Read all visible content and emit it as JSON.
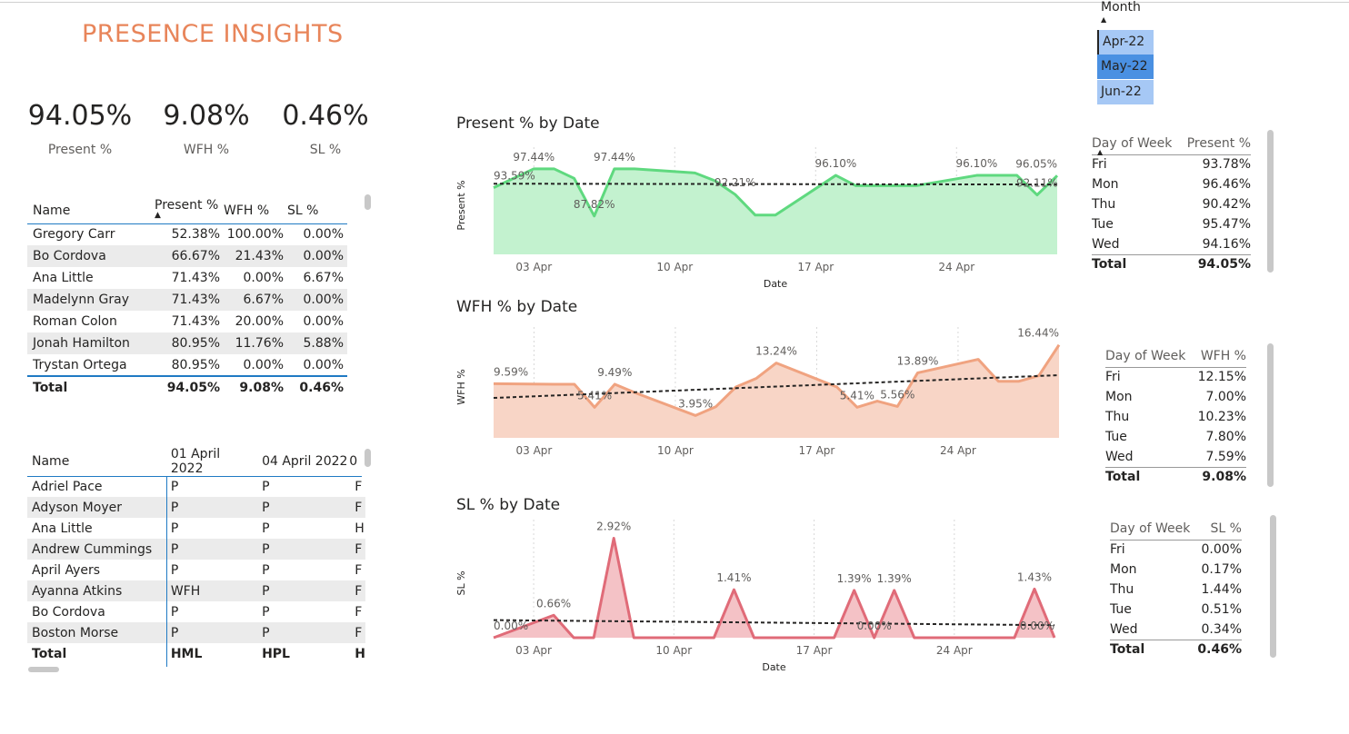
{
  "header": {
    "title": "PRESENCE INSIGHTS"
  },
  "kpis": [
    {
      "value": "94.05%",
      "label": "Present %"
    },
    {
      "value": "9.08%",
      "label": "WFH %"
    },
    {
      "value": "0.46%",
      "label": "SL %"
    }
  ],
  "month_slicer": {
    "label": "Month",
    "items": [
      "Apr-22",
      "May-22",
      "Jun-22"
    ],
    "selected": "May-22"
  },
  "summary_table": {
    "columns": [
      "Name",
      "Present %",
      "WFH %",
      "SL %"
    ],
    "rows": [
      [
        "Gregory Carr",
        "52.38%",
        "100.00%",
        "0.00%"
      ],
      [
        "Bo Cordova",
        "66.67%",
        "21.43%",
        "0.00%"
      ],
      [
        "Ana Little",
        "71.43%",
        "0.00%",
        "6.67%"
      ],
      [
        "Madelynn Gray",
        "71.43%",
        "6.67%",
        "0.00%"
      ],
      [
        "Roman Colon",
        "71.43%",
        "20.00%",
        "0.00%"
      ],
      [
        "Jonah Hamilton",
        "80.95%",
        "11.76%",
        "5.88%"
      ],
      [
        "Trystan Ortega",
        "80.95%",
        "0.00%",
        "0.00%"
      ]
    ],
    "total": [
      "Total",
      "94.05%",
      "9.08%",
      "0.46%"
    ]
  },
  "matrix_table": {
    "columns": [
      "Name",
      "01 April 2022",
      "04 April 2022",
      "0"
    ],
    "rows": [
      [
        "Adriel Pace",
        "P",
        "P",
        "F"
      ],
      [
        "Adyson Moyer",
        "P",
        "P",
        "F"
      ],
      [
        "Ana Little",
        "P",
        "P",
        "H"
      ],
      [
        "Andrew Cummings",
        "P",
        "P",
        "F"
      ],
      [
        "April Ayers",
        "P",
        "P",
        "F"
      ],
      [
        "Ayanna Atkins",
        "WFH",
        "P",
        "F"
      ],
      [
        "Bo Cordova",
        "P",
        "P",
        "F"
      ],
      [
        "Boston Morse",
        "P",
        "P",
        "F"
      ]
    ],
    "total": [
      "Total",
      "HML",
      "HPL",
      "H"
    ]
  },
  "day_tables": [
    {
      "columns": [
        "Day of Week",
        "Present %"
      ],
      "rows": [
        [
          "Fri",
          "93.78%"
        ],
        [
          "Mon",
          "96.46%"
        ],
        [
          "Thu",
          "90.42%"
        ],
        [
          "Tue",
          "95.47%"
        ],
        [
          "Wed",
          "94.16%"
        ]
      ],
      "total": [
        "Total",
        "94.05%"
      ]
    },
    {
      "columns": [
        "Day of Week",
        "WFH %"
      ],
      "rows": [
        [
          "Fri",
          "12.15%"
        ],
        [
          "Mon",
          "7.00%"
        ],
        [
          "Thu",
          "10.23%"
        ],
        [
          "Tue",
          "7.80%"
        ],
        [
          "Wed",
          "7.59%"
        ]
      ],
      "total": [
        "Total",
        "9.08%"
      ]
    },
    {
      "columns": [
        "Day of Week",
        "SL %"
      ],
      "rows": [
        [
          "Fri",
          "0.00%"
        ],
        [
          "Mon",
          "0.17%"
        ],
        [
          "Thu",
          "1.44%"
        ],
        [
          "Tue",
          "0.51%"
        ],
        [
          "Wed",
          "0.34%"
        ]
      ],
      "total": [
        "Total",
        "0.46%"
      ]
    }
  ],
  "chart_data": [
    {
      "type": "area",
      "title": "Present % by Date",
      "xlabel": "Date",
      "ylabel": "Present %",
      "x_ticks": [
        "03 Apr",
        "10 Apr",
        "17 Apr",
        "24 Apr"
      ],
      "color": "#5fd97f",
      "fill": "#c3f2cf",
      "trend": true,
      "ylim": [
        80,
        100
      ],
      "x": [
        "2022-04-01",
        "2022-04-03",
        "2022-04-04",
        "2022-04-05",
        "2022-04-06",
        "2022-04-07",
        "2022-04-08",
        "2022-04-11",
        "2022-04-12",
        "2022-04-13",
        "2022-04-14",
        "2022-04-15",
        "2022-04-18",
        "2022-04-19",
        "2022-04-20",
        "2022-04-21",
        "2022-04-22",
        "2022-04-25",
        "2022-04-26",
        "2022-04-27",
        "2022-04-28",
        "2022-04-29"
      ],
      "values": [
        93.59,
        97.44,
        97.44,
        95.5,
        87.82,
        97.44,
        97.44,
        96.6,
        95.0,
        92.21,
        88.0,
        88.0,
        96.1,
        94.0,
        94.0,
        94.0,
        94.0,
        96.1,
        96.1,
        96.1,
        92.11,
        96.05
      ],
      "labels": [
        {
          "x": "2022-04-01",
          "text": "93.59%"
        },
        {
          "x": "2022-04-03",
          "text": "97.44%"
        },
        {
          "x": "2022-04-06",
          "text": "87.82%"
        },
        {
          "x": "2022-04-07",
          "text": "97.44%"
        },
        {
          "x": "2022-04-13",
          "text": "92.21%"
        },
        {
          "x": "2022-04-18",
          "text": "96.10%"
        },
        {
          "x": "2022-04-25",
          "text": "96.10%"
        },
        {
          "x": "2022-04-28",
          "text": "92.11%"
        },
        {
          "x": "2022-04-29",
          "text": "96.05%"
        }
      ]
    },
    {
      "type": "area",
      "title": "WFH % by Date",
      "xlabel": "",
      "ylabel": "WFH %",
      "x_ticks": [
        "03 Apr",
        "10 Apr",
        "17 Apr",
        "24 Apr"
      ],
      "color": "#f0a380",
      "fill": "#f8d5c6",
      "trend": true,
      "ylim": [
        0,
        18
      ],
      "x": [
        "2022-04-01",
        "2022-04-04",
        "2022-04-05",
        "2022-04-06",
        "2022-04-07",
        "2022-04-08",
        "2022-04-11",
        "2022-04-12",
        "2022-04-13",
        "2022-04-14",
        "2022-04-15",
        "2022-04-18",
        "2022-04-19",
        "2022-04-20",
        "2022-04-21",
        "2022-04-22",
        "2022-04-25",
        "2022-04-26",
        "2022-04-27",
        "2022-04-28",
        "2022-04-29"
      ],
      "values": [
        9.59,
        9.49,
        9.49,
        5.41,
        9.49,
        8.0,
        3.95,
        5.5,
        9.0,
        10.5,
        13.24,
        9.0,
        5.41,
        6.5,
        5.56,
        11.5,
        13.89,
        10.0,
        10.0,
        11.0,
        16.44
      ],
      "labels": [
        {
          "x": "2022-04-01",
          "text": "9.59%"
        },
        {
          "x": "2022-04-06",
          "text": "5.41%"
        },
        {
          "x": "2022-04-07",
          "text": "9.49%"
        },
        {
          "x": "2022-04-11",
          "text": "3.95%"
        },
        {
          "x": "2022-04-15",
          "text": "13.24%"
        },
        {
          "x": "2022-04-19",
          "text": "5.41%"
        },
        {
          "x": "2022-04-21",
          "text": "5.56%"
        },
        {
          "x": "2022-04-22",
          "text": "13.89%"
        },
        {
          "x": "2022-04-29",
          "text": "16.44%"
        }
      ]
    },
    {
      "type": "area",
      "title": "SL % by Date",
      "xlabel": "Date",
      "ylabel": "SL %",
      "x_ticks": [
        "03 Apr",
        "10 Apr",
        "17 Apr",
        "24 Apr"
      ],
      "color": "#e06b78",
      "fill": "#f4c2c6",
      "trend": true,
      "ylim": [
        0,
        3.2
      ],
      "x": [
        "2022-04-01",
        "2022-04-04",
        "2022-04-05",
        "2022-04-06",
        "2022-04-07",
        "2022-04-08",
        "2022-04-11",
        "2022-04-12",
        "2022-04-13",
        "2022-04-14",
        "2022-04-15",
        "2022-04-18",
        "2022-04-19",
        "2022-04-20",
        "2022-04-21",
        "2022-04-22",
        "2022-04-25",
        "2022-04-26",
        "2022-04-27",
        "2022-04-28",
        "2022-04-29"
      ],
      "values": [
        0.0,
        0.66,
        0.0,
        0.0,
        2.92,
        0.0,
        0.0,
        0.0,
        1.41,
        0.0,
        0.0,
        0.0,
        1.39,
        0.0,
        1.39,
        0.0,
        0.0,
        0.0,
        0.0,
        1.43,
        0.0
      ],
      "labels": [
        {
          "x": "2022-04-01",
          "text": "0.00%"
        },
        {
          "x": "2022-04-04",
          "text": "0.66%"
        },
        {
          "x": "2022-04-07",
          "text": "2.92%"
        },
        {
          "x": "2022-04-13",
          "text": "1.41%"
        },
        {
          "x": "2022-04-19",
          "text": "1.39%"
        },
        {
          "x": "2022-04-20",
          "text": "0.00%"
        },
        {
          "x": "2022-04-21",
          "text": "1.39%"
        },
        {
          "x": "2022-04-28",
          "text": "1.43%"
        },
        {
          "x": "2022-04-29",
          "text": "0.00%"
        }
      ]
    }
  ]
}
